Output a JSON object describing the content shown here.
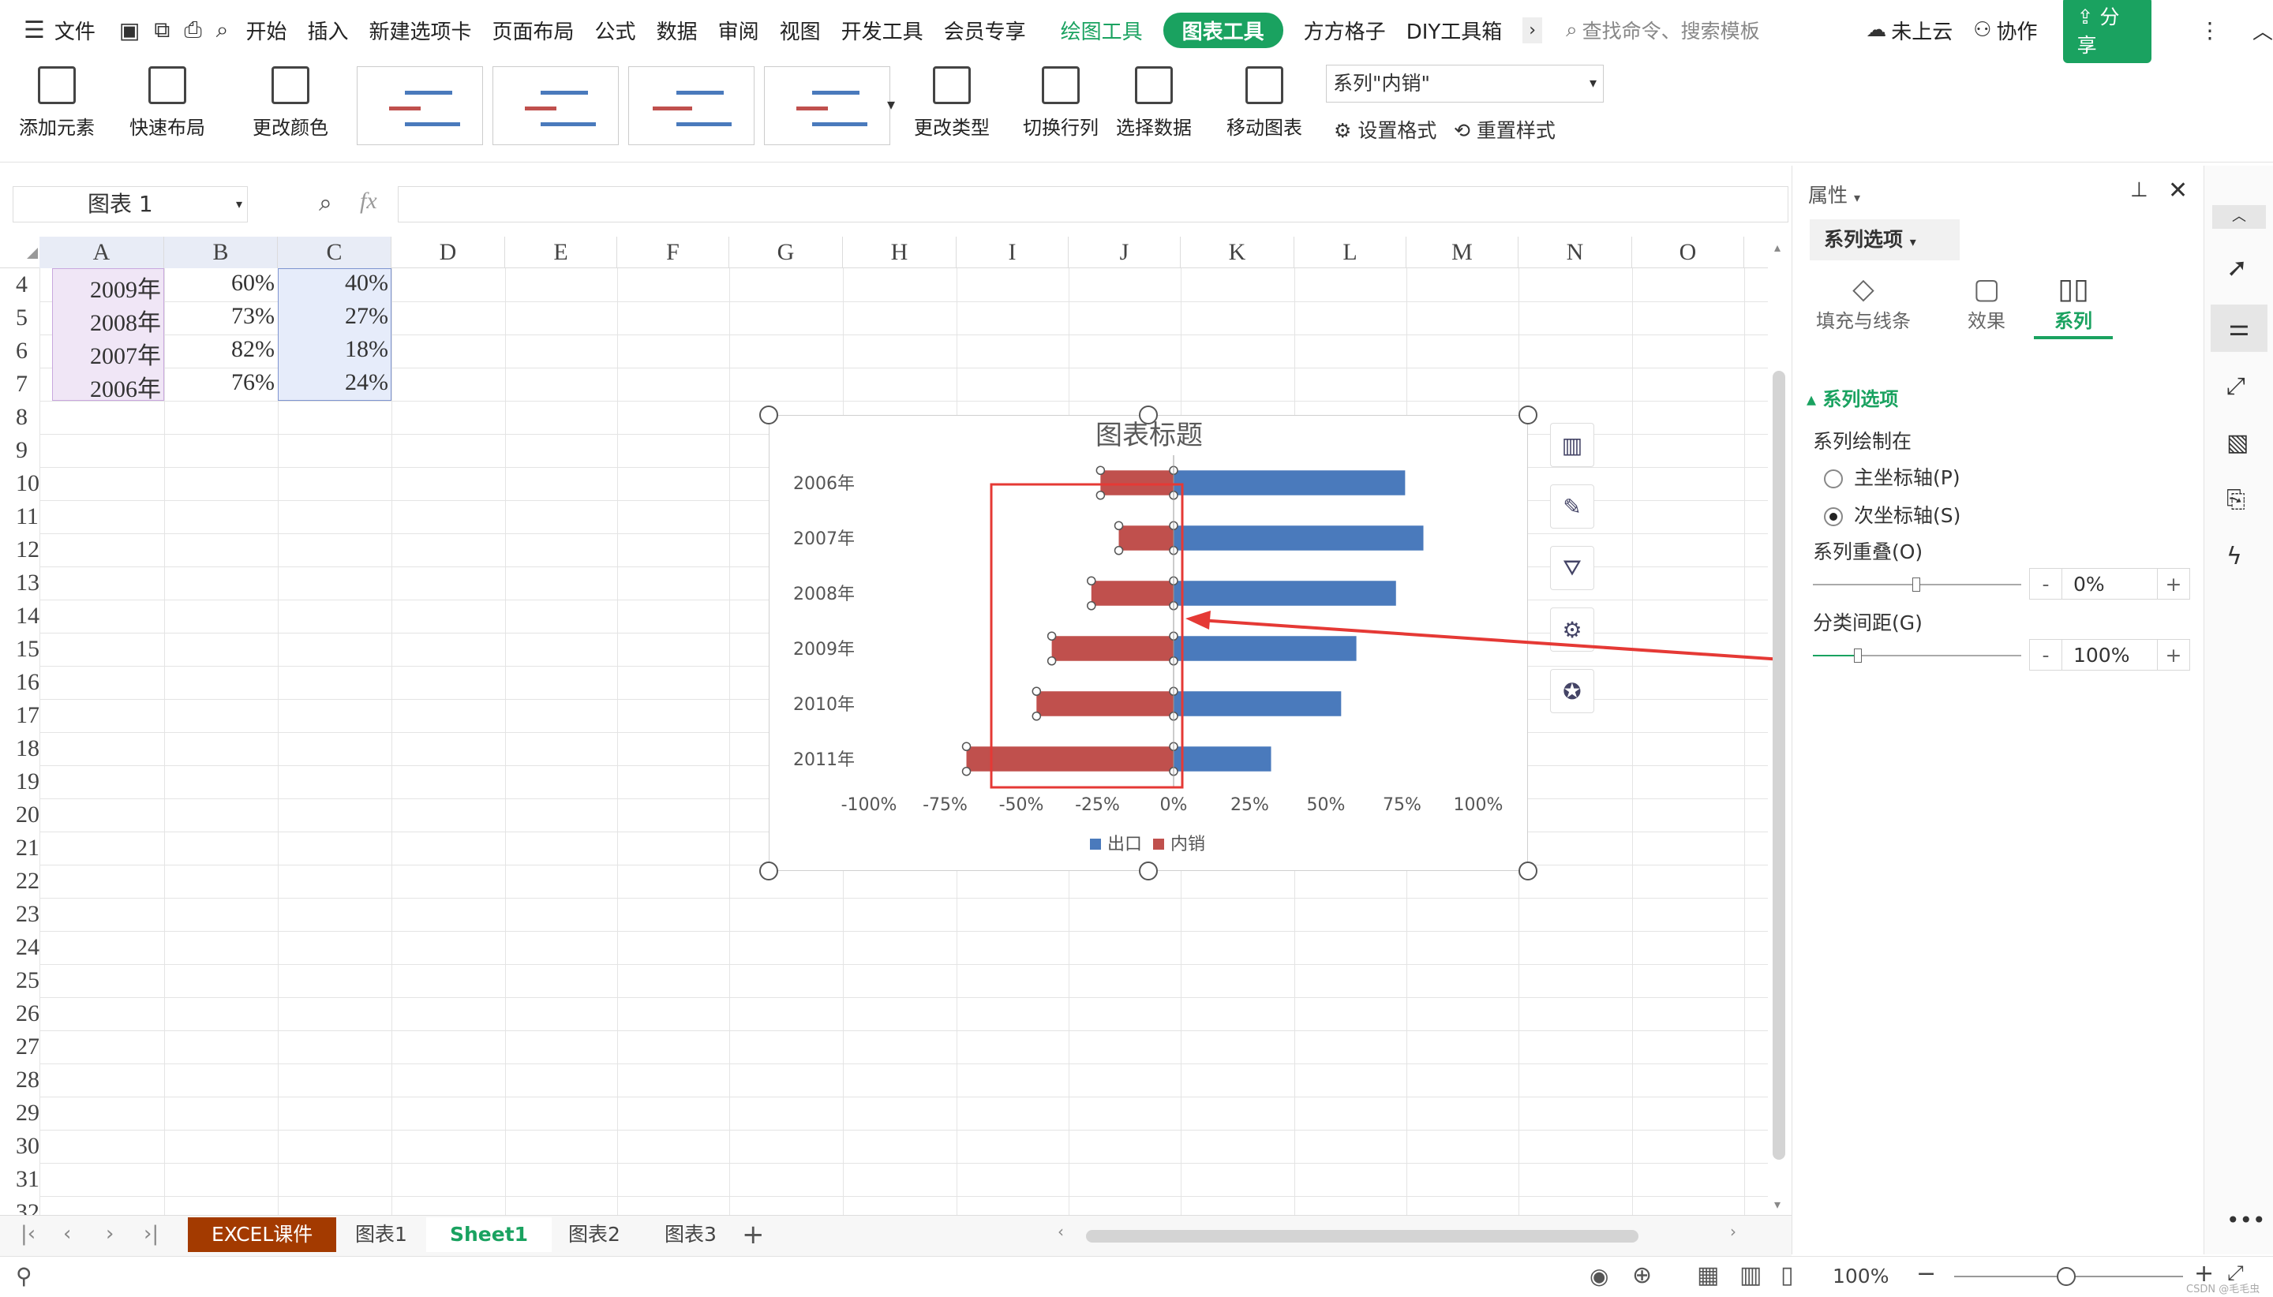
{
  "menubar": {
    "file": "文件",
    "items": [
      "开始",
      "插入",
      "新建选项卡",
      "页面布局",
      "公式",
      "数据",
      "审阅",
      "视图",
      "开发工具",
      "会员专享"
    ],
    "draw_tools": "绘图工具",
    "chart_tools": "图表工具",
    "extra": [
      "方方格子",
      "DIY工具箱"
    ],
    "search_placeholder": "查找命令、搜索模板",
    "cloud": "未上云",
    "collab": "协作",
    "share": "分享"
  },
  "ribbon": {
    "add_element": "添加元素",
    "quick_layout": "快速布局",
    "change_color": "更改颜色",
    "change_type": "更改类型",
    "switch_rowcol": "切换行列",
    "select_data": "选择数据",
    "move_chart": "移动图表",
    "series_select": "系列\"内销\"",
    "set_format": "设置格式",
    "reset_style": "重置样式"
  },
  "formula_bar": {
    "name_box": "图表 1",
    "fx": "fx"
  },
  "grid": {
    "columns": [
      "A",
      "B",
      "C",
      "D",
      "E",
      "F",
      "G",
      "H",
      "I",
      "J",
      "K",
      "L",
      "M",
      "N",
      "O"
    ],
    "rows": [
      "4",
      "5",
      "6",
      "7",
      "8",
      "9",
      "10",
      "11",
      "12",
      "13",
      "14",
      "15",
      "16",
      "17",
      "18",
      "19",
      "20",
      "21",
      "22",
      "23",
      "24",
      "25",
      "26",
      "27",
      "28",
      "29",
      "30",
      "31",
      "32"
    ],
    "data": [
      [
        "2009年",
        "60%",
        "40%"
      ],
      [
        "2008年",
        "73%",
        "27%"
      ],
      [
        "2007年",
        "82%",
        "18%"
      ],
      [
        "2006年",
        "76%",
        "24%"
      ]
    ]
  },
  "chart_data": {
    "type": "bar",
    "title": "图表标题",
    "categories": [
      "2006年",
      "2007年",
      "2008年",
      "2009年",
      "2010年",
      "2011年"
    ],
    "series": [
      {
        "name": "出口",
        "values": [
          76,
          82,
          73,
          60,
          55,
          32
        ],
        "color": "#4a7abc"
      },
      {
        "name": "内销",
        "values": [
          -24,
          -18,
          -27,
          -40,
          -45,
          -68
        ],
        "color": "#c0504d"
      }
    ],
    "xlim": [
      -100,
      100
    ],
    "xticks": [
      "-100%",
      "-75%",
      "-50%",
      "-25%",
      "0%",
      "25%",
      "50%",
      "75%",
      "100%"
    ],
    "legend_position": "bottom"
  },
  "panel": {
    "title": "属性",
    "tab": "系列选项",
    "subtabs": [
      "填充与线条",
      "效果",
      "系列"
    ],
    "section": "系列选项",
    "plot_on": "系列绘制在",
    "primary_axis": "主坐标轴(P)",
    "secondary_axis": "次坐标轴(S)",
    "overlap_label": "系列重叠(O)",
    "overlap_value": "0%",
    "gap_label": "分类间距(G)",
    "gap_value": "100%"
  },
  "sheets": [
    "EXCEL课件",
    "图表1",
    "Sheet1",
    "图表2",
    "图表3"
  ],
  "status": {
    "zoom": "100%",
    "watermark": "CSDN @毛毛虫"
  },
  "colors": {
    "accent": "#1aa260",
    "annotation": "#e53935",
    "bar_blue": "#4a7abc",
    "bar_red": "#c0504d"
  }
}
